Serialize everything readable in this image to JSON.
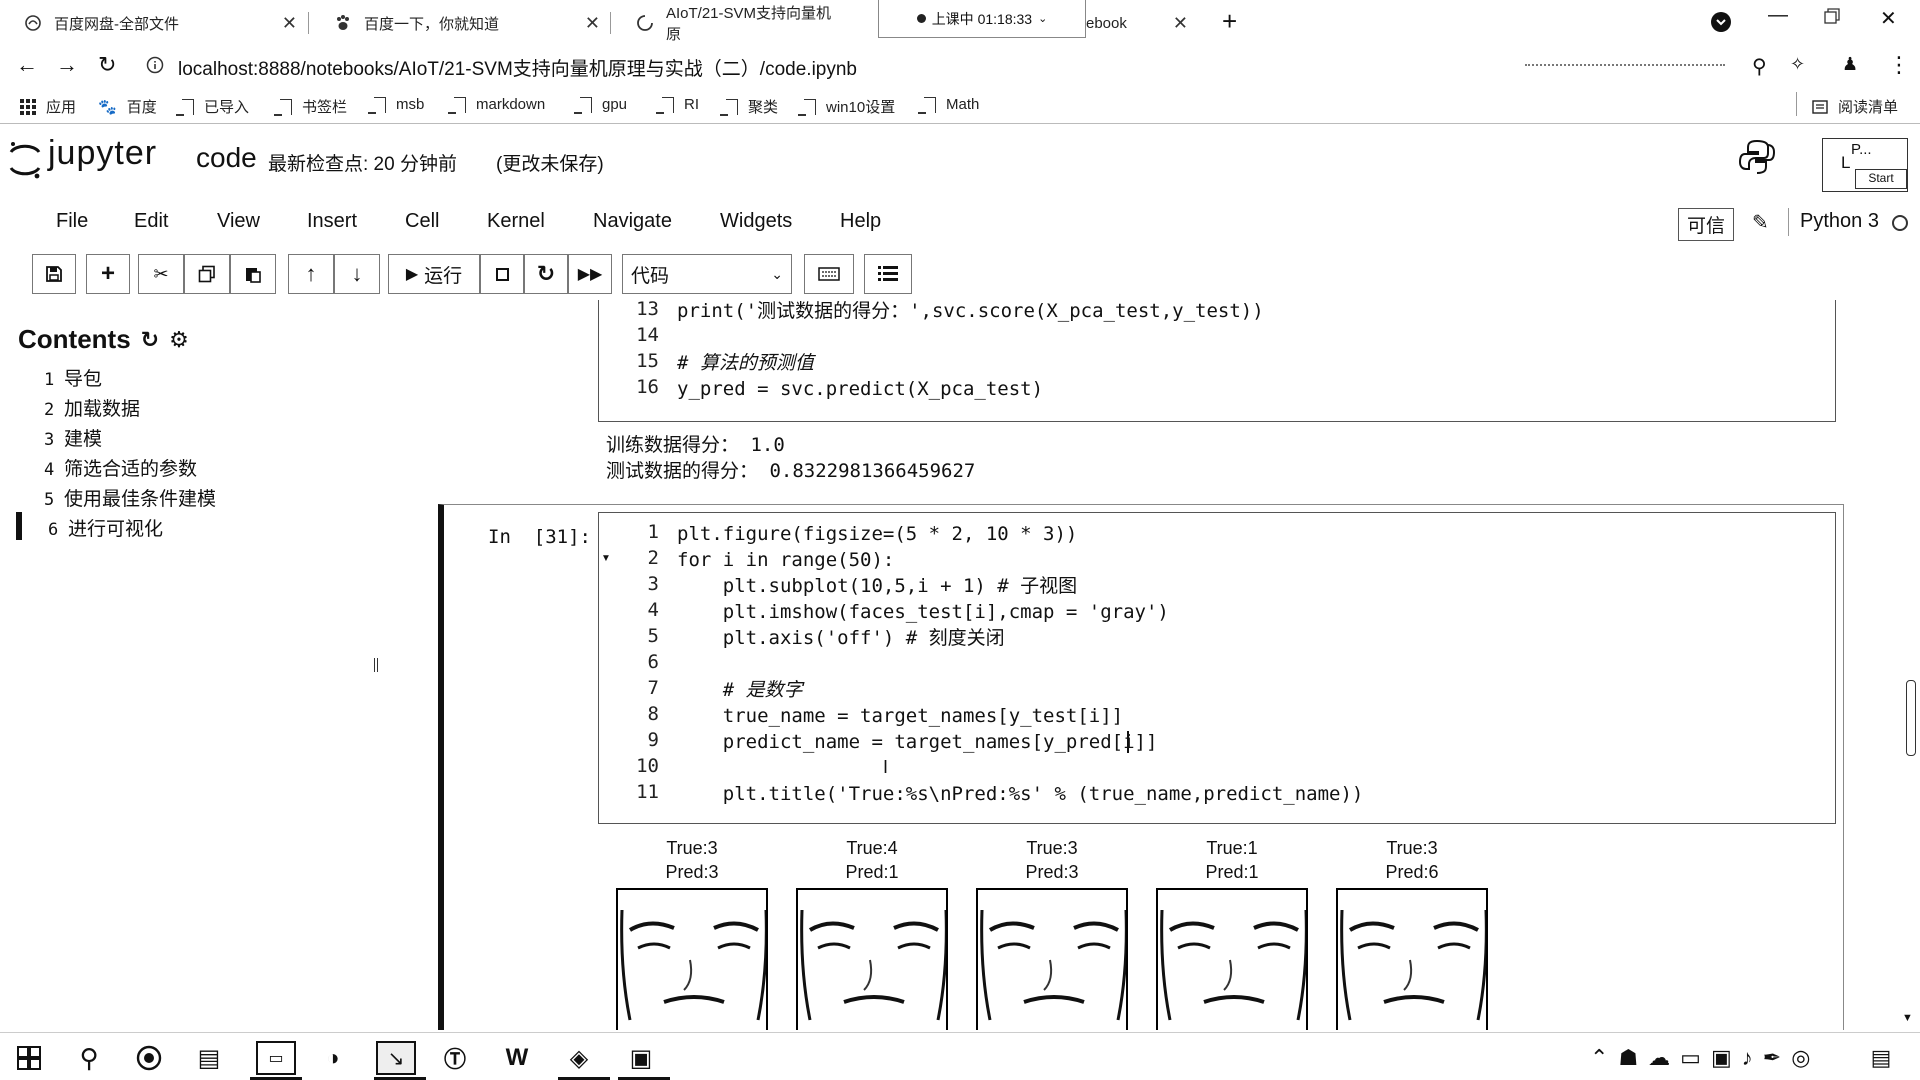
{
  "browser": {
    "tabs": [
      {
        "title": "百度网盘-全部文件"
      },
      {
        "title": "百度一下，你就知道"
      },
      {
        "title": "AIoT/21-SVM支持向量机原"
      },
      {
        "title": "ebook"
      }
    ],
    "recording_label": "上课中 01:18:33",
    "url": "localhost:8888/notebooks/AIoT/21-SVM支持向量机原理与实战（二）/code.ipynb"
  },
  "bookmarks": [
    "应用",
    "百度",
    "已导入",
    "书签栏",
    "msb",
    "markdown",
    "gpu",
    "RI",
    "聚类",
    "win10设置",
    "Math"
  ],
  "reading_list": "阅读清单",
  "jupyter": {
    "logo_text": "jupyter",
    "notebook_name": "code",
    "checkpoint": "最新检查点: 20 分钟前",
    "unsaved": "(更改未保存)",
    "widget_p": "P...",
    "widget_l": "L",
    "widget_start": "Start",
    "menu": [
      "File",
      "Edit",
      "View",
      "Insert",
      "Cell",
      "Kernel",
      "Navigate",
      "Widgets",
      "Help"
    ],
    "trusted": "可信",
    "kernel": "Python 3",
    "run_label": "运行",
    "cell_type": "代码"
  },
  "toc": {
    "title": "Contents",
    "items": [
      {
        "num": "1",
        "label": "导包"
      },
      {
        "num": "2",
        "label": "加载数据"
      },
      {
        "num": "3",
        "label": "建模"
      },
      {
        "num": "4",
        "label": "筛选合适的参数"
      },
      {
        "num": "5",
        "label": "使用最佳条件建模"
      },
      {
        "num": "6",
        "label": "进行可视化"
      }
    ]
  },
  "cell_prev": {
    "lines": [
      {
        "n": "13",
        "code": "print('测试数据的得分：',svc.score(X_pca_test,y_test))"
      },
      {
        "n": "14",
        "code": ""
      },
      {
        "n": "15",
        "code": "# 算法的预测值"
      },
      {
        "n": "16",
        "code": "y_pred = svc.predict(X_pca_test)"
      }
    ],
    "output": [
      "训练数据得分： 1.0",
      "测试数据的得分： 0.8322981366459627"
    ]
  },
  "cell_current": {
    "prompt": "In  [31]:",
    "lines": [
      {
        "n": "1",
        "code": "plt.figure(figsize=(5 * 2, 10 * 3))"
      },
      {
        "n": "2",
        "code": "for i in range(50):"
      },
      {
        "n": "3",
        "code": "    plt.subplot(10,5,i + 1) # 子视图"
      },
      {
        "n": "4",
        "code": "    plt.imshow(faces_test[i],cmap = 'gray')"
      },
      {
        "n": "5",
        "code": "    plt.axis('off') # 刻度关闭"
      },
      {
        "n": "6",
        "code": ""
      },
      {
        "n": "7",
        "code": "    # 是数字"
      },
      {
        "n": "8",
        "code": "    true_name = target_names[y_test[i]]"
      },
      {
        "n": "9",
        "code": "    predict_name = target_names[y_pred[i]]"
      },
      {
        "n": "10",
        "code": ""
      },
      {
        "n": "11",
        "code": "    plt.title('True:%s\\nPred:%s' % (true_name,predict_name))"
      }
    ]
  },
  "faces": [
    {
      "true": "True:3",
      "pred": "Pred:3"
    },
    {
      "true": "True:4",
      "pred": "Pred:1"
    },
    {
      "true": "True:3",
      "pred": "Pred:3"
    },
    {
      "true": "True:1",
      "pred": "Pred:1"
    },
    {
      "true": "True:3",
      "pred": "Pred:6"
    }
  ]
}
